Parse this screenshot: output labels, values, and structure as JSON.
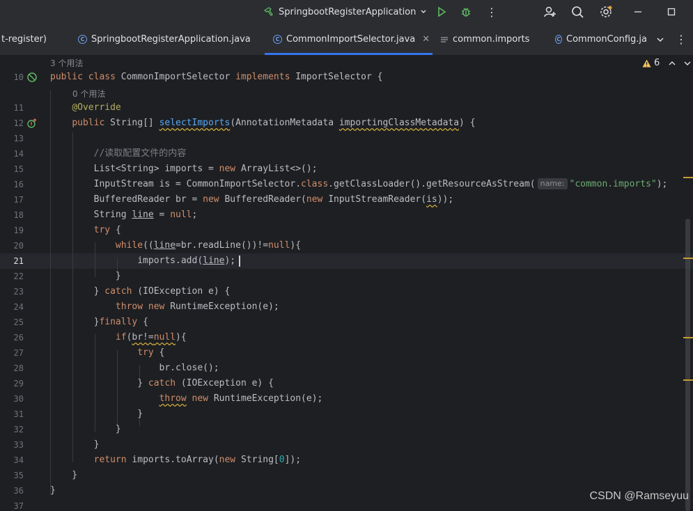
{
  "titlebar": {
    "run_config": "SpringbootRegisterApplication",
    "icons": [
      "hammer-icon",
      "chevron-down-icon",
      "run-icon",
      "debug-icon",
      "more-vert-icon",
      "add-user-icon",
      "search-icon",
      "settings-icon",
      "minimize-icon",
      "maximize-icon",
      "close-icon"
    ]
  },
  "tabs": [
    {
      "label": "t-register)"
    },
    {
      "label": "SpringbootRegisterApplication.java"
    },
    {
      "label": "CommonImportSelector.java"
    },
    {
      "label": "common.imports"
    },
    {
      "label": "CommonConfig.ja"
    }
  ],
  "editor": {
    "warnings_count": "6",
    "hints": {
      "usages_class": "3 个用法",
      "usages_method": "0 个用法"
    },
    "line_numbers": [
      "10",
      "11",
      "12",
      "13",
      "14",
      "15",
      "16",
      "17",
      "18",
      "19",
      "20",
      "21",
      "22",
      "23",
      "24",
      "25",
      "26",
      "27",
      "28",
      "29",
      "30",
      "31",
      "32",
      "33",
      "34",
      "35",
      "36",
      "37"
    ],
    "param_hint": "name:",
    "comment": "//读取配置文件的内容",
    "string_value": "\"common.imports\""
  },
  "watermark": "CSDN @Ramseyuu"
}
